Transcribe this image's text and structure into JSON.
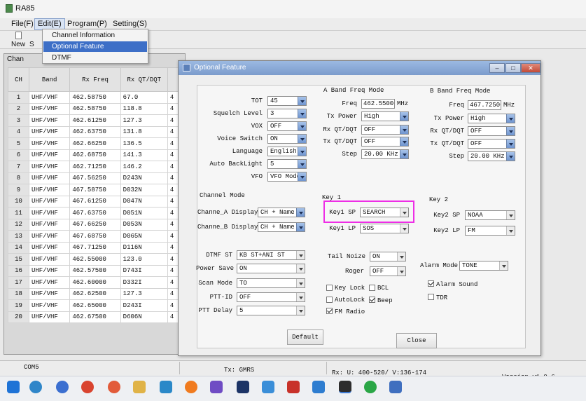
{
  "app": {
    "title": "RA85"
  },
  "menu": {
    "file": "File(F)",
    "edit": "Edit(E)",
    "program": "Program(P)",
    "setting": "Setting(S)"
  },
  "toolbar": {
    "new": "New",
    "s": "S"
  },
  "edit_menu": {
    "items": [
      "Channel Information",
      "Optional Feature",
      "DTMF"
    ]
  },
  "channel_window": {
    "title": "Chan",
    "headers": [
      "CH",
      "Band",
      "Rx Freq",
      "Rx QT/DQT",
      ""
    ],
    "rows": [
      [
        "1",
        "UHF/VHF",
        "462.58750",
        "67.0",
        "4"
      ],
      [
        "2",
        "UHF/VHF",
        "462.58750",
        "118.8",
        "4"
      ],
      [
        "3",
        "UHF/VHF",
        "462.61250",
        "127.3",
        "4"
      ],
      [
        "4",
        "UHF/VHF",
        "462.63750",
        "131.8",
        "4"
      ],
      [
        "5",
        "UHF/VHF",
        "462.66250",
        "136.5",
        "4"
      ],
      [
        "6",
        "UHF/VHF",
        "462.68750",
        "141.3",
        "4"
      ],
      [
        "7",
        "UHF/VHF",
        "462.71250",
        "146.2",
        "4"
      ],
      [
        "8",
        "UHF/VHF",
        "467.56250",
        "D243N",
        "4"
      ],
      [
        "9",
        "UHF/VHF",
        "467.58750",
        "D032N",
        "4"
      ],
      [
        "10",
        "UHF/VHF",
        "467.61250",
        "D047N",
        "4"
      ],
      [
        "11",
        "UHF/VHF",
        "467.63750",
        "D051N",
        "4"
      ],
      [
        "12",
        "UHF/VHF",
        "467.66250",
        "D053N",
        "4"
      ],
      [
        "13",
        "UHF/VHF",
        "467.68750",
        "D065N",
        "4"
      ],
      [
        "14",
        "UHF/VHF",
        "467.71250",
        "D116N",
        "4"
      ],
      [
        "15",
        "UHF/VHF",
        "462.55000",
        "123.0",
        "4"
      ],
      [
        "16",
        "UHF/VHF",
        "462.57500",
        "D743I",
        "4"
      ],
      [
        "17",
        "UHF/VHF",
        "462.60000",
        "D332I",
        "4"
      ],
      [
        "18",
        "UHF/VHF",
        "462.62500",
        "127.3",
        "4"
      ],
      [
        "19",
        "UHF/VHF",
        "462.65000",
        "D243I",
        "4"
      ],
      [
        "20",
        "UHF/VHF",
        "462.67500",
        "D606N",
        "4"
      ]
    ]
  },
  "dialog": {
    "title": "Optional Feature",
    "general": {
      "tot": {
        "label": "TOT",
        "value": "45"
      },
      "squelch": {
        "label": "Squelch Level",
        "value": "3"
      },
      "vox": {
        "label": "VOX",
        "value": "OFF"
      },
      "voice": {
        "label": "Voice Switch",
        "value": "ON"
      },
      "language": {
        "label": "Language",
        "value": "English"
      },
      "backlight": {
        "label": "Auto BackLight",
        "value": "5"
      },
      "vfo": {
        "label": "VFO",
        "value": "VFO Mode"
      }
    },
    "a_band": {
      "title": "A Band Freq Mode",
      "freq": {
        "label": "Freq",
        "value": "462.55000",
        "unit": "MHz"
      },
      "tx_power": {
        "label": "Tx Power",
        "value": "High"
      },
      "rx_qt": {
        "label": "Rx QT/DQT",
        "value": "OFF"
      },
      "tx_qt": {
        "label": "Tx QT/DQT",
        "value": "OFF"
      },
      "step": {
        "label": "Step",
        "value": "20.00 KHz"
      }
    },
    "b_band": {
      "title": "B Band Freq Mode",
      "freq": {
        "label": "Freq",
        "value": "467.72500",
        "unit": "MHz"
      },
      "tx_power": {
        "label": "Tx Power",
        "value": "High"
      },
      "rx_qt": {
        "label": "Rx QT/DQT",
        "value": "OFF"
      },
      "tx_qt": {
        "label": "Tx QT/DQT",
        "value": "OFF"
      },
      "step": {
        "label": "Step",
        "value": "20.00 KHz"
      }
    },
    "channel_mode": {
      "title": "Channel Mode",
      "a_display": {
        "label": "Channe_A Display",
        "value": "CH + Name"
      },
      "b_display": {
        "label": "Channe_B Display",
        "value": "CH + Name"
      }
    },
    "key1": {
      "title": "Key 1",
      "sp": {
        "label": "Key1 SP",
        "value": "SEARCH"
      },
      "lp": {
        "label": "Key1 LP",
        "value": "SOS"
      }
    },
    "key2": {
      "title": "Key 2",
      "sp": {
        "label": "Key2 SP",
        "value": "NOAA"
      },
      "lp": {
        "label": "Key2 LP",
        "value": "FM"
      }
    },
    "dtmf": {
      "dtmf_st": {
        "label": "DTMF ST",
        "value": "KB ST+ANI ST"
      },
      "power_save": {
        "label": "Power Save",
        "value": "ON"
      },
      "scan_mode": {
        "label": "Scan Mode",
        "value": "TO"
      },
      "ptt_id": {
        "label": "PTT-ID",
        "value": "OFF"
      },
      "ptt_delay": {
        "label": "PTT Delay",
        "value": "5"
      }
    },
    "misc": {
      "tail_noise": {
        "label": "Tail Noize",
        "value": "ON"
      },
      "roger": {
        "label": "Roger",
        "value": "OFF"
      },
      "alarm_mode": {
        "label": "Alarm Mode",
        "value": "TONE"
      }
    },
    "checks": {
      "key_lock": {
        "label": "Key Lock",
        "checked": false
      },
      "bcl": {
        "label": "BCL",
        "checked": false
      },
      "autolock": {
        "label": "AutoLock",
        "checked": false
      },
      "beep": {
        "label": "Beep",
        "checked": true
      },
      "fm_radio": {
        "label": "FM Radio",
        "checked": true
      },
      "alarm_sound": {
        "label": "Alarm Sound",
        "checked": true
      },
      "tdr": {
        "label": "TDR",
        "checked": false
      }
    },
    "buttons": {
      "default": "Default",
      "close": "Close"
    },
    "highlight_color": "#ee2ee6"
  },
  "statusbar": {
    "port": "COM5",
    "tx": "Tx: GMRS",
    "rx": "Rx: U: 400-520/ V:136-174",
    "version": "Version v1.0.6"
  },
  "taskbar": {
    "icons": [
      "windows-icon",
      "search-icon",
      "app-icon",
      "chrome-icon",
      "app-icon",
      "folder-icon",
      "app-icon",
      "firefox-icon",
      "vs-icon",
      "photoshop-icon",
      "app-icon",
      "wps-icon",
      "app-icon",
      "radio-program-icon",
      "wechat-icon",
      "app-icon"
    ]
  }
}
